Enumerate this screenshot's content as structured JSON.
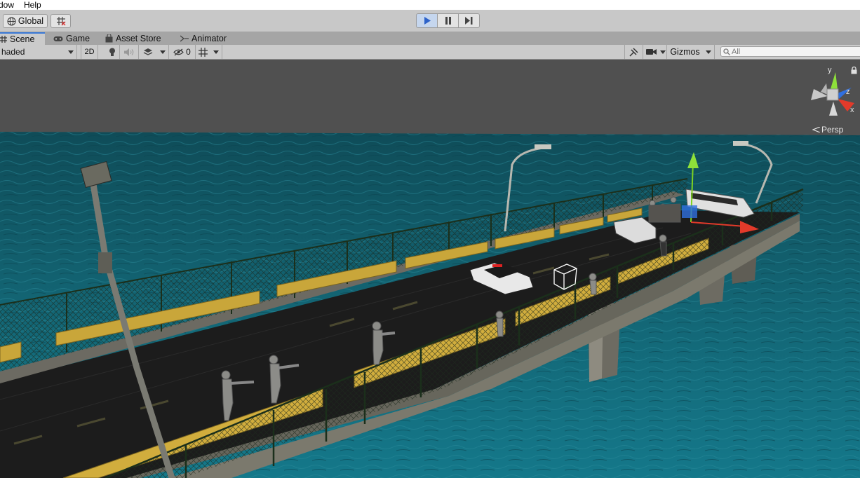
{
  "menu": {
    "items": [
      "dow",
      "Help"
    ]
  },
  "toolbar": {
    "global_label": "Global",
    "play_icons": [
      "play-icon",
      "pause-icon",
      "step-icon"
    ],
    "play_active": "play"
  },
  "tabs": [
    {
      "label": "Scene",
      "icon": "scene-hash-icon",
      "active": true
    },
    {
      "label": "Game",
      "icon": "gamepad-icon",
      "active": false
    },
    {
      "label": "Asset Store",
      "icon": "bag-icon",
      "active": false
    },
    {
      "label": "Animator",
      "icon": "animator-icon",
      "active": false
    }
  ],
  "scene_toolbar": {
    "shading_mode": "haded",
    "mode_2d": "2D",
    "hidden_count": "0",
    "gizmos_label": "Gizmos",
    "search_placeholder": "All"
  },
  "viewport": {
    "projection_label": "Persp",
    "axes": {
      "y": "y",
      "z": "z",
      "x": "x"
    },
    "colors": {
      "sky": "#505050",
      "water": "#0f5f6e",
      "axis_y": "#8ee03a",
      "axis_x": "#e23a2a",
      "axis_z": "#2f6fe0"
    }
  }
}
